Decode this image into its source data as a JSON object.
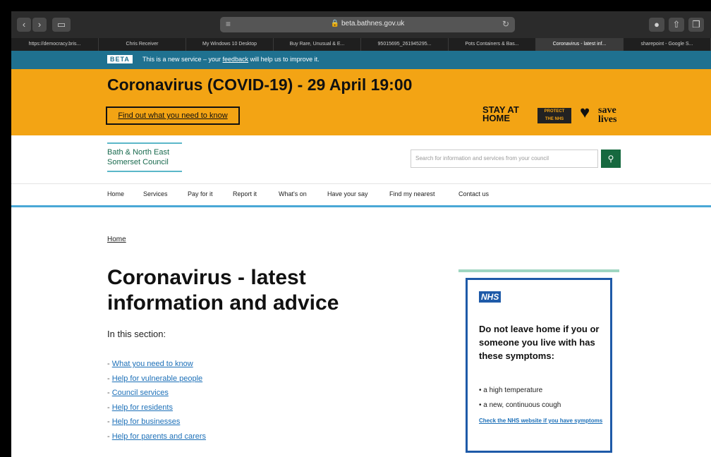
{
  "browser": {
    "url": "beta.bathnes.gov.uk",
    "tabs": [
      {
        "label": "https://democracy.bris...",
        "active": false
      },
      {
        "label": "Chris Receiver",
        "active": false
      },
      {
        "label": "My Windows 10 Desktop",
        "active": false
      },
      {
        "label": "Buy Rare, Unusual & E...",
        "active": false
      },
      {
        "label": "95015695_261945295...",
        "active": false
      },
      {
        "label": "Pots Containers & Bas...",
        "active": false
      },
      {
        "label": "Coronavirus - latest inf...",
        "active": true
      },
      {
        "label": "sharepoint - Google S...",
        "active": false
      }
    ]
  },
  "beta_banner": {
    "tag": "BETA",
    "text_before": "This is a new service – your ",
    "link": "feedback",
    "text_after": " will help us to improve it."
  },
  "covid_banner": {
    "title": "Coronavirus (COVID-19) - 29 April 19:00",
    "button": "Find out what you need to know",
    "slogan_stay": "STAY AT",
    "slogan_home": "HOME",
    "slogan_protect": "PROTECT",
    "slogan_nhs": "THE NHS",
    "slogan_save": "save",
    "slogan_lives": "lives"
  },
  "header": {
    "logo_line1": "Bath & North East",
    "logo_line2": "Somerset Council",
    "search_placeholder": "Search for information and services from your council"
  },
  "nav": {
    "items": [
      "Home",
      "Services",
      "Pay for it",
      "Report it",
      "What's on",
      "Have your say",
      "Find my nearest",
      "Contact us"
    ]
  },
  "main": {
    "breadcrumb": "Home",
    "title": "Coronavirus - latest information and advice",
    "section_label": "In this section:",
    "links": [
      "What you need to know",
      "Help for vulnerable people",
      "Council services",
      "Help for residents",
      "Help for businesses",
      "Help for parents and carers"
    ]
  },
  "nhs": {
    "logo": "NHS",
    "heading": "Do not leave home if you or someone you live with has these symptoms:",
    "symptoms": [
      "a high temperature",
      "a new, continuous cough"
    ],
    "link": "Check the NHS website if you have symptoms"
  },
  "colors": {
    "beta_bar": "#1f7190",
    "covid_banner": "#f3a414",
    "nhs_blue": "#1e5aa8",
    "council_green": "#16693f"
  }
}
